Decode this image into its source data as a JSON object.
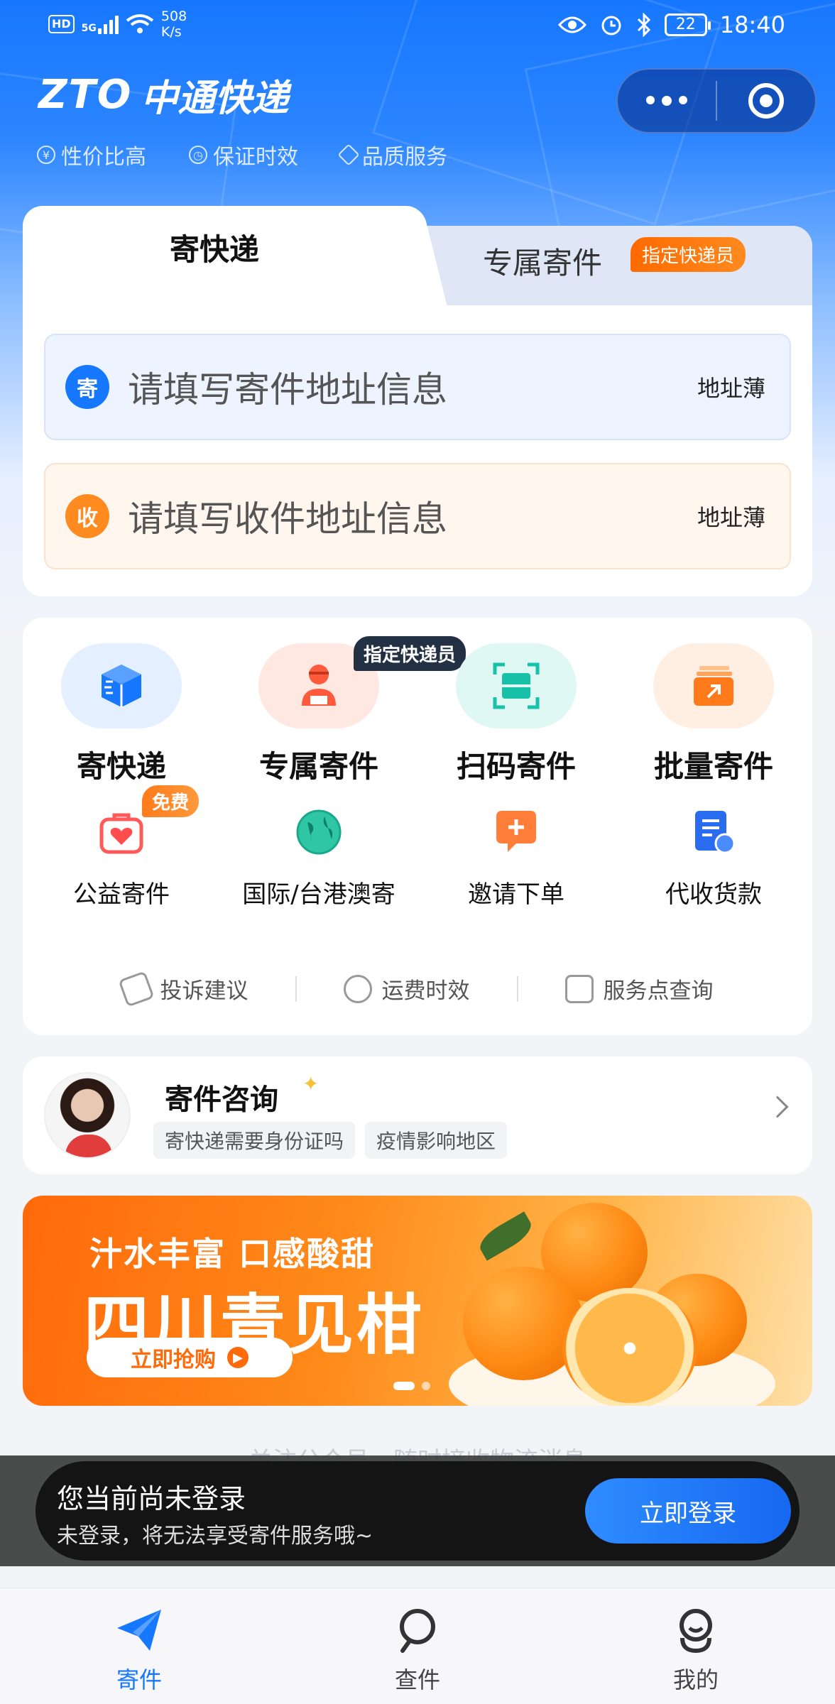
{
  "status_bar": {
    "hd": "HD",
    "network": "5G",
    "speed_value": "508",
    "speed_unit": "K/s",
    "battery": "22",
    "time": "18:40"
  },
  "header": {
    "brand_logo": "ZTO",
    "brand_name": "中通快递",
    "features": [
      {
        "icon": "yen-icon",
        "label": "性价比高"
      },
      {
        "icon": "clock-icon",
        "label": "保证时效"
      },
      {
        "icon": "diamond-icon",
        "label": "品质服务"
      }
    ]
  },
  "send_tabs": {
    "active": "寄快递",
    "other": "专属寄件",
    "other_badge": "指定快递员"
  },
  "address": {
    "sender_chip": "寄",
    "sender_placeholder": "请填写寄件地址信息",
    "receiver_chip": "收",
    "receiver_placeholder": "请填写收件地址信息",
    "address_book": "地址薄"
  },
  "services": {
    "primary": [
      {
        "label": "寄快递",
        "icon": "package-icon"
      },
      {
        "label": "专属寄件",
        "icon": "courier-icon",
        "badge": "指定快递员"
      },
      {
        "label": "扫码寄件",
        "icon": "scan-icon"
      },
      {
        "label": "批量寄件",
        "icon": "batch-icon"
      }
    ],
    "secondary": [
      {
        "label": "公益寄件",
        "icon": "charity-bag-icon",
        "badge": "免费"
      },
      {
        "label": "国际/台港澳寄",
        "icon": "globe-icon"
      },
      {
        "label": "邀请下单",
        "icon": "invite-chat-icon"
      },
      {
        "label": "代收货款",
        "icon": "cod-document-icon"
      }
    ],
    "links": [
      {
        "label": "投诉建议",
        "icon": "feedback-icon"
      },
      {
        "label": "运费时效",
        "icon": "fee-clock-icon"
      },
      {
        "label": "服务点查询",
        "icon": "service-point-icon"
      }
    ]
  },
  "consult": {
    "title": "寄件咨询",
    "tags": [
      "寄快递需要身份证吗",
      "疫情影响地区"
    ]
  },
  "banner": {
    "subtitle": "汁水丰富 口感酸甜",
    "title": "四川青见柑",
    "button": "立即抢购"
  },
  "follow_row": {
    "hidden_text_1": "关注公众号",
    "hidden_text_2": "随时接收物流消息"
  },
  "toast": {
    "title": "您当前尚未登录",
    "subtitle": "未登录，将无法享受寄件服务哦~",
    "button": "立即登录"
  },
  "tabbar": {
    "items": [
      {
        "label": "寄件",
        "icon": "send-plane-icon",
        "active": true
      },
      {
        "label": "查件",
        "icon": "search-icon",
        "active": false
      },
      {
        "label": "我的",
        "icon": "profile-icon",
        "active": false
      }
    ]
  },
  "colors": {
    "brand_blue": "#1677ff",
    "accent_orange": "#ff6a00"
  }
}
